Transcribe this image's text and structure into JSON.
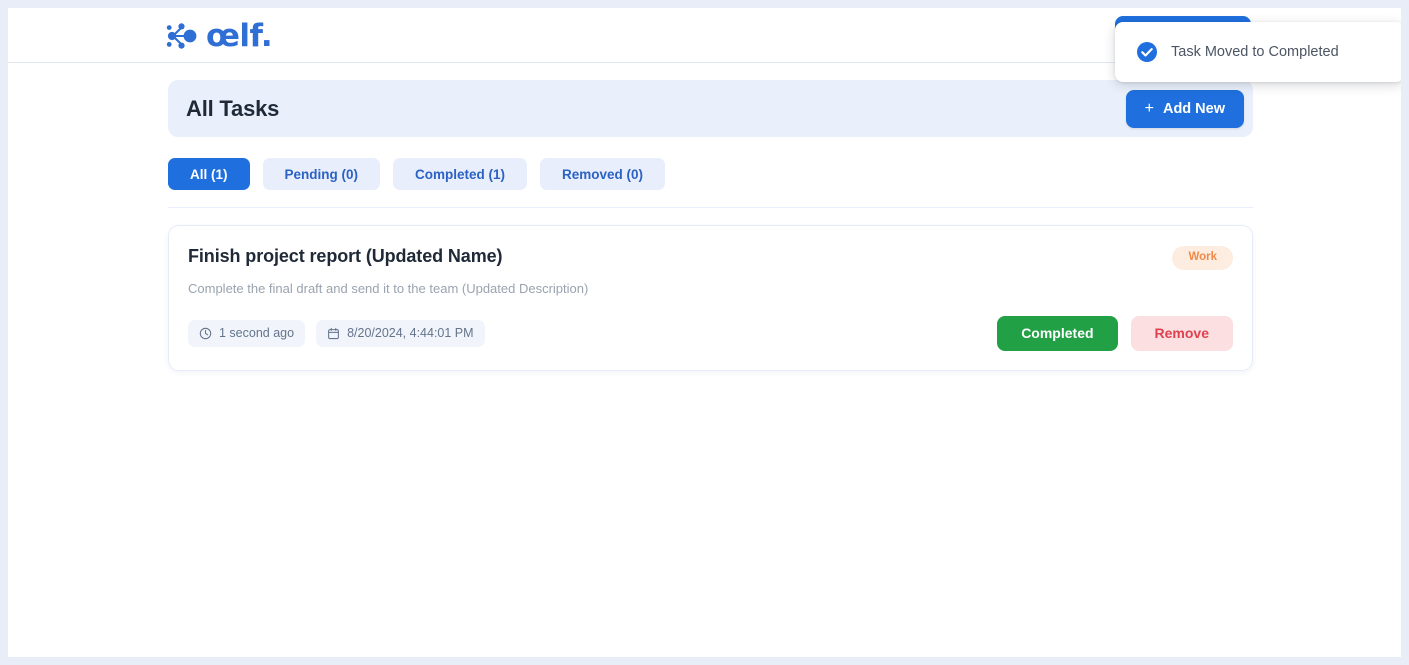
{
  "brand": {
    "wordmark": "œlf.",
    "logo_icon": "aelf-node-cluster-icon",
    "color": "#2f6ed5"
  },
  "list_header": {
    "title": "All Tasks",
    "add_button": {
      "label": "Add New",
      "plus_glyph": "+",
      "color": "#1f6fde"
    }
  },
  "tabs": [
    {
      "label": "All (1)",
      "active": true
    },
    {
      "label": "Pending (0)",
      "active": false
    },
    {
      "label": "Completed (1)",
      "active": false
    },
    {
      "label": "Removed (0)",
      "active": false
    }
  ],
  "task": {
    "title": "Finish project report (Updated Name)",
    "description": "Complete the final draft and send it to the team (Updated Description)",
    "badge": {
      "label": "Work",
      "text_color": "#ef8b4b",
      "background_color": "#fdece0"
    },
    "meta": [
      {
        "icon": "clock-icon",
        "text": "1 second ago"
      },
      {
        "icon": "calendar-icon",
        "text": "8/20/2024, 4:44:01 PM"
      }
    ],
    "actions": {
      "completed_label": "Completed",
      "completed_color": "#22a045",
      "remove_label": "Remove",
      "remove_color": "#e0414f"
    }
  },
  "toast": {
    "message": "Task Moved to Completed",
    "icon": "check-circle-icon",
    "icon_color": "#1f6fde"
  }
}
